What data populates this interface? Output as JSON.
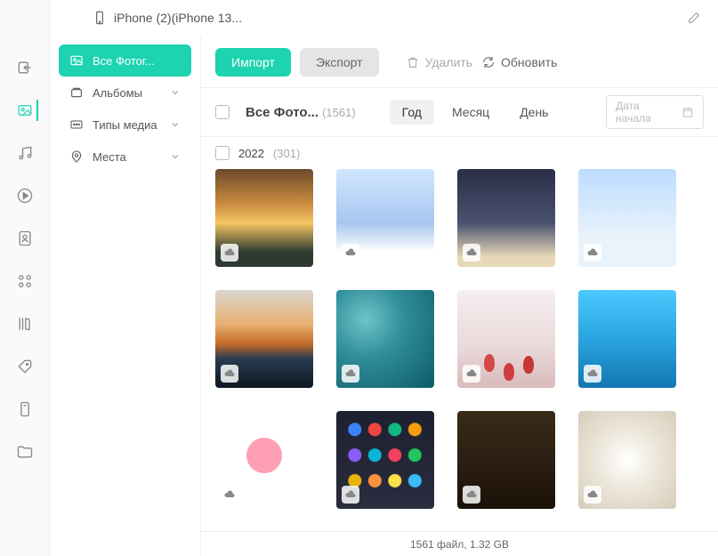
{
  "titlebar": {
    "device_label": "iPhone (2)(iPhone 13..."
  },
  "rail": {
    "items": [
      {
        "name": "transfer-icon"
      },
      {
        "name": "photos-icon",
        "active": true
      },
      {
        "name": "music-icon"
      },
      {
        "name": "play-icon"
      },
      {
        "name": "contacts-icon"
      },
      {
        "name": "apps-icon"
      },
      {
        "name": "books-icon"
      },
      {
        "name": "tags-icon"
      },
      {
        "name": "storage-icon"
      },
      {
        "name": "folder-icon"
      }
    ]
  },
  "sidebar": {
    "items": [
      {
        "label": "Все Фотог...",
        "icon": "image-icon",
        "active": true
      },
      {
        "label": "Альбомы",
        "icon": "albums-icon",
        "expandable": true
      },
      {
        "label": "Типы медиа",
        "icon": "media-type-icon",
        "expandable": true
      },
      {
        "label": "Места",
        "icon": "location-icon",
        "expandable": true
      }
    ]
  },
  "toolbar": {
    "import_label": "Импорт",
    "export_label": "Экспорт",
    "delete_label": "Удалить",
    "refresh_label": "Обновить"
  },
  "filterbar": {
    "all_label": "Все Фото...",
    "all_count": "(1561)",
    "tabs": [
      {
        "label": "Год",
        "active": true
      },
      {
        "label": "Месяц",
        "active": false
      },
      {
        "label": "День",
        "active": false
      }
    ],
    "date_placeholder": "Дата начала"
  },
  "group": {
    "year_label": "2022",
    "year_count": "(301)"
  },
  "statusbar": {
    "text": "1561 файл, 1.32 GB"
  },
  "colors": {
    "accent": "#1dd3b0"
  }
}
